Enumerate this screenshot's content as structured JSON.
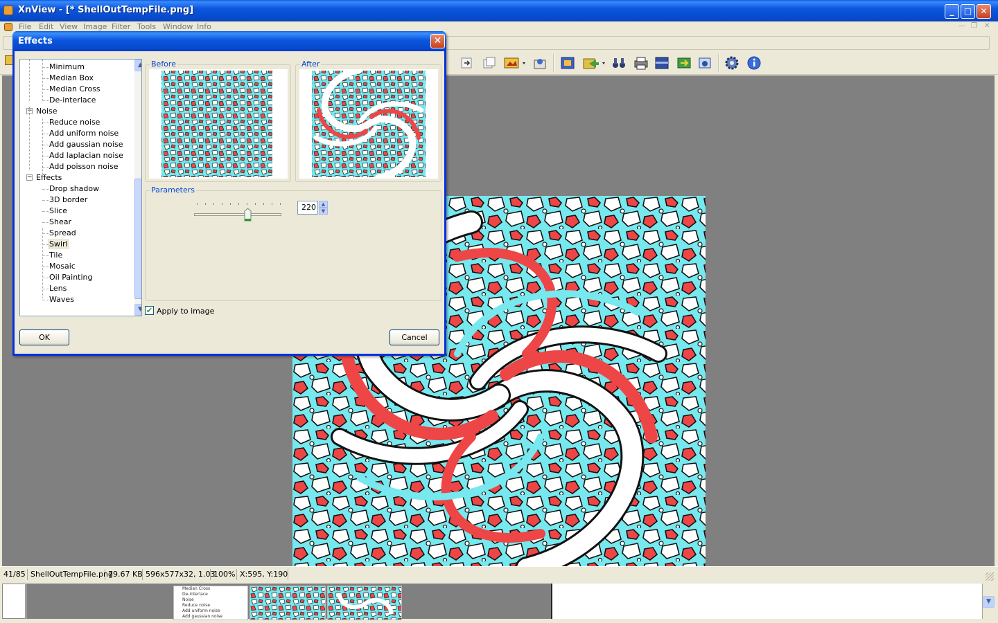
{
  "window": {
    "title": "XnView - [* ShellOutTempFile.png]"
  },
  "menu": [
    "File",
    "Edit",
    "View",
    "Image",
    "Filter",
    "Tools",
    "Window",
    "Info"
  ],
  "dialog": {
    "title": "Effects",
    "tree": [
      {
        "label": "Minimum",
        "level": 2
      },
      {
        "label": "Median Box",
        "level": 2
      },
      {
        "label": "Median Cross",
        "level": 2
      },
      {
        "label": "De-interlace",
        "level": 2
      },
      {
        "label": "Noise",
        "level": 1
      },
      {
        "label": "Reduce noise",
        "level": 2
      },
      {
        "label": "Add uniform noise",
        "level": 2
      },
      {
        "label": "Add gaussian noise",
        "level": 2
      },
      {
        "label": "Add laplacian noise",
        "level": 2
      },
      {
        "label": "Add poisson noise",
        "level": 2
      },
      {
        "label": "Effects",
        "level": 1
      },
      {
        "label": "Drop shadow",
        "level": 2
      },
      {
        "label": "3D border",
        "level": 2
      },
      {
        "label": "Slice",
        "level": 2
      },
      {
        "label": "Shear",
        "level": 2
      },
      {
        "label": "Spread",
        "level": 2
      },
      {
        "label": "Swirl",
        "level": 2,
        "selected": true
      },
      {
        "label": "Tile",
        "level": 2
      },
      {
        "label": "Mosaic",
        "level": 2
      },
      {
        "label": "Oil Painting",
        "level": 2
      },
      {
        "label": "Lens",
        "level": 2
      },
      {
        "label": "Waves",
        "level": 2
      }
    ],
    "before_label": "Before",
    "after_label": "After",
    "params_label": "Parameters",
    "swirl_value": "220",
    "slider_fraction": 0.6,
    "apply_label": "Apply to image",
    "apply_checked": true,
    "ok_label": "OK",
    "cancel_label": "Cancel"
  },
  "status": {
    "index": "41/85",
    "filename": "ShellOutTempFile.png",
    "filesize": "79.67 KB",
    "dimensions": "596x577x32, 1.03",
    "zoom": "100%",
    "coords": "X:595, Y:190"
  },
  "colors": {
    "cyan": "#76e8ee",
    "red": "#ee4646",
    "outline": "#111111",
    "titlebar": "#0b56e0"
  }
}
